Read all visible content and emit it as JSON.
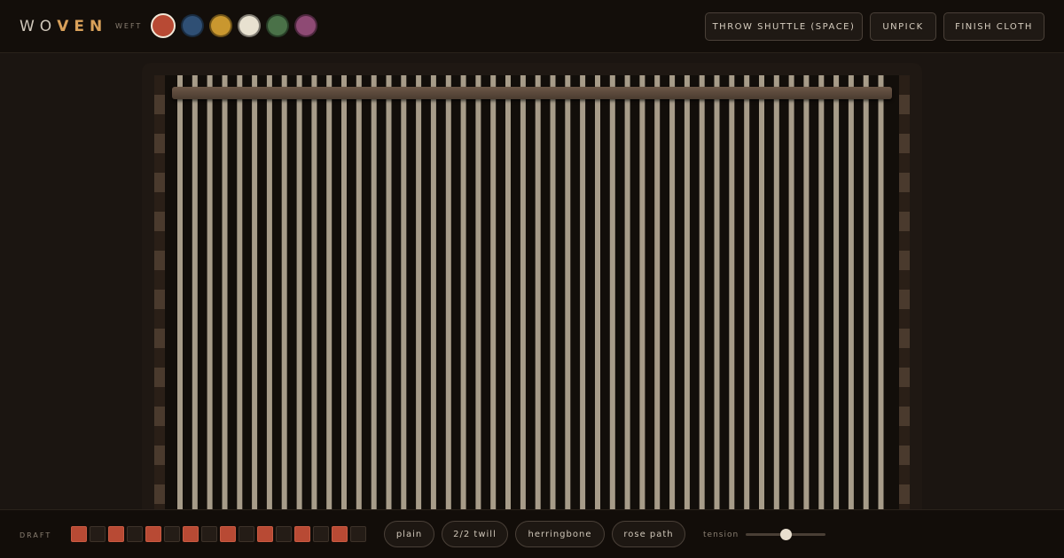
{
  "app": {
    "logo_part1": "WO",
    "logo_part2": "VEN"
  },
  "weft": {
    "label": "WEFT",
    "selected_index": 0,
    "swatches": [
      {
        "color": "#b84a34",
        "name": "red-swatch"
      },
      {
        "color": "#2f4f74",
        "name": "blue-swatch"
      },
      {
        "color": "#c9972f",
        "name": "gold-swatch"
      },
      {
        "color": "#e8e1d0",
        "name": "cream-swatch"
      },
      {
        "color": "#4a7148",
        "name": "green-swatch"
      },
      {
        "color": "#8e4a74",
        "name": "plum-swatch"
      }
    ]
  },
  "toolbar": {
    "throw_label": "THROW SHUTTLE (SPACE)",
    "unpick_label": "UNPICK",
    "finish_label": "FINISH CLOTH"
  },
  "loom": {
    "warp_color": "#a79c89",
    "selvedge_dark": "#2a1f17",
    "selvedge_light": "#4a3a2d"
  },
  "draft": {
    "label": "DRAFT",
    "cells": [
      true,
      false,
      true,
      false,
      true,
      false,
      true,
      false,
      true,
      false,
      true,
      false,
      true,
      false,
      true,
      false
    ]
  },
  "patterns": {
    "plain": "plain",
    "twill": "2/2 twill",
    "herringbone": "herringbone",
    "rose_path": "rose path"
  },
  "tension": {
    "label": "tension",
    "value": 0.5
  }
}
